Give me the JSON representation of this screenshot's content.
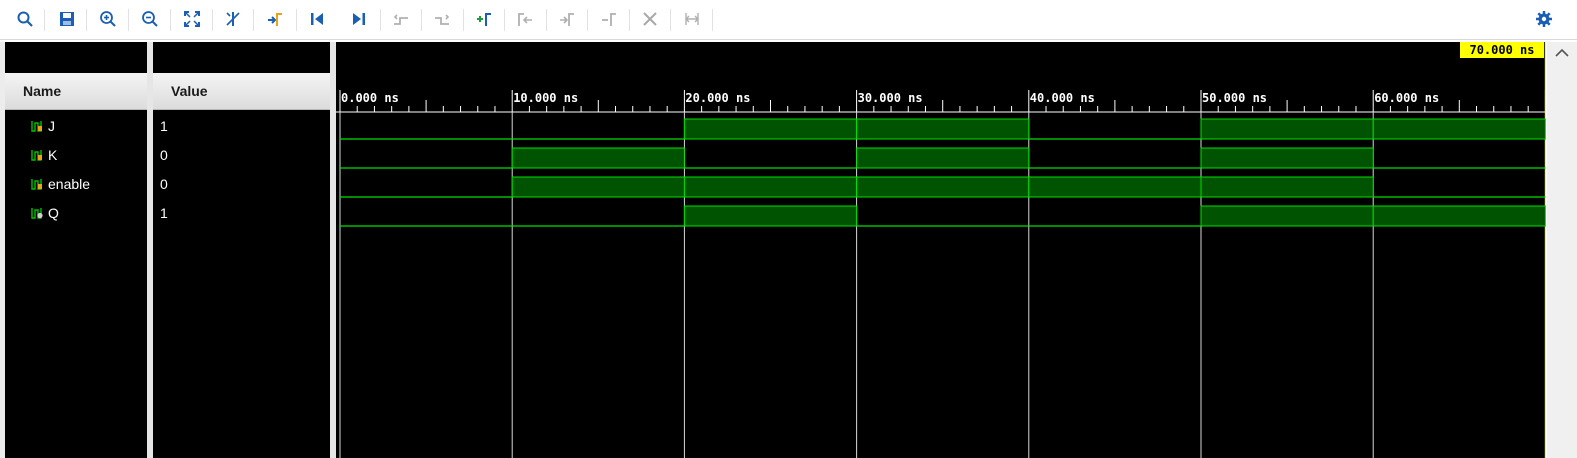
{
  "toolbar": {
    "icons": [
      "search-icon",
      "save-icon",
      "zoom-in-icon",
      "zoom-out-icon",
      "zoom-fit-icon",
      "cursor-to-zero-icon",
      "go-to-time-icon",
      "go-to-start-icon",
      "go-to-end-icon",
      "previous-transition-icon",
      "next-transition-icon",
      "add-marker-icon",
      "previous-marker-icon",
      "next-marker-icon",
      "swap-cursors-icon",
      "delete-marker-icon",
      "snap-to-transition-icon",
      "settings-icon"
    ]
  },
  "columns": {
    "name": "Name",
    "value": "Value"
  },
  "signals": [
    {
      "name": "J",
      "value": "1"
    },
    {
      "name": "K",
      "value": "0"
    },
    {
      "name": "enable",
      "value": "0"
    },
    {
      "name": "Q",
      "value": "1"
    }
  ],
  "timeline": {
    "cursor_label": "70.000 ns",
    "ticks": [
      "0.000 ns",
      "10.000 ns",
      "20.000 ns",
      "30.000 ns",
      "40.000 ns",
      "50.000 ns",
      "60.000 ns"
    ]
  },
  "colors": {
    "wave": "#00e000",
    "wave_fill": "#005300",
    "cursor": "#ffff00",
    "accent": "#1a5fb4"
  },
  "waveforms": {
    "time_ns": [
      0,
      10,
      20,
      30,
      40,
      50,
      60,
      70
    ],
    "J": [
      0,
      0,
      1,
      1,
      0,
      1,
      1
    ],
    "K": [
      0,
      1,
      0,
      1,
      0,
      1,
      0
    ],
    "enable": [
      0,
      1,
      1,
      1,
      1,
      1,
      0
    ],
    "Q": [
      0,
      0,
      1,
      0,
      0,
      1,
      1
    ]
  }
}
